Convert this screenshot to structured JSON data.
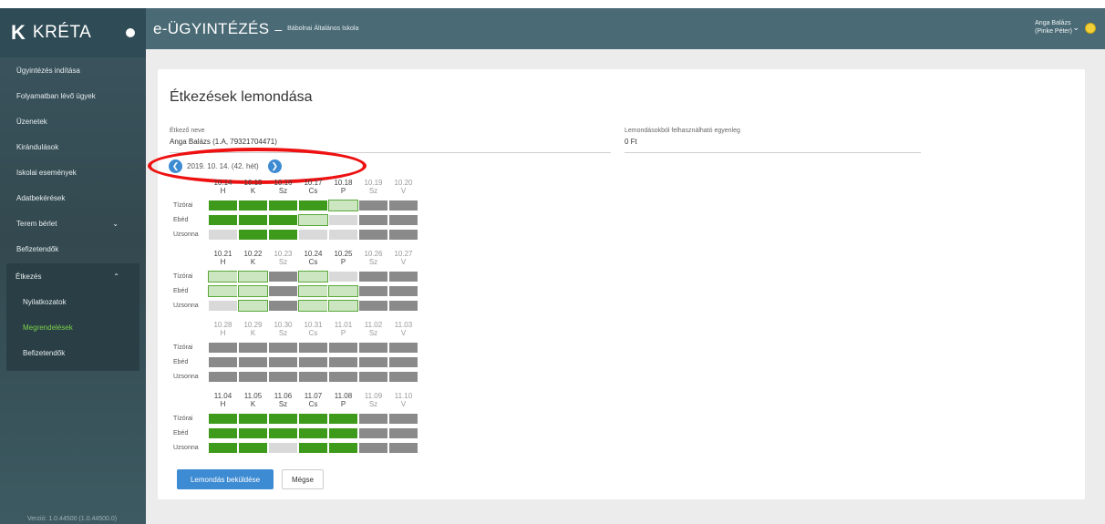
{
  "brand": {
    "name": "KRÉTA"
  },
  "header": {
    "app_title": "e-ÜGYINTÉZÉS",
    "dash": "–",
    "school": "Bábolnai Általános Iskola",
    "user_line1": "Anga Balázs",
    "user_line2": "(Pinke Péter)"
  },
  "sidebar": {
    "items": [
      {
        "label": "Ügyintézés indítása"
      },
      {
        "label": "Folyamatban lévő ügyek"
      },
      {
        "label": "Üzenetek"
      },
      {
        "label": "Kirándulások"
      },
      {
        "label": "Iskolai események"
      },
      {
        "label": "Adatbekérések"
      },
      {
        "label": "Terem bérlet"
      },
      {
        "label": "Befizetendők"
      }
    ],
    "group": {
      "label": "Étkezés",
      "children": [
        {
          "label": "Nyilatkozatok"
        },
        {
          "label": "Megrendelések"
        },
        {
          "label": "Befizetendők"
        }
      ]
    },
    "version": "Verzió: 1.0.44500 (1.0.44500.0)"
  },
  "page": {
    "title": "Étkezések lemondása",
    "etkezo_label": "Étkező neve",
    "etkezo_value": "Anga Balázs (1.A, 79321704471)",
    "egyenleg_label": "Lemondásokból felhasználható egyenleg",
    "egyenleg_value": "0 Ft",
    "week_label": "2019. 10. 14. (42. hét)",
    "submit_label": "Lemondás beküldése",
    "cancel_label": "Mégse"
  },
  "row_labels": [
    "Tízórai",
    "Ebéd",
    "Uzsonna"
  ],
  "weeks": [
    {
      "days": [
        {
          "date": "10.14",
          "day": "H",
          "dim": false
        },
        {
          "date": "10.15",
          "day": "K",
          "dim": false
        },
        {
          "date": "10.16",
          "day": "Sz",
          "dim": false
        },
        {
          "date": "10.17",
          "day": "Cs",
          "dim": false
        },
        {
          "date": "10.18",
          "day": "P",
          "dim": false
        },
        {
          "date": "10.19",
          "day": "Sz",
          "dim": true
        },
        {
          "date": "10.20",
          "day": "V",
          "dim": true
        }
      ],
      "rows": [
        [
          "g",
          "g",
          "g",
          "g",
          "gx",
          "d",
          "d"
        ],
        [
          "g",
          "g",
          "g",
          "gx",
          "l",
          "d",
          "d"
        ],
        [
          "l",
          "g",
          "g",
          "l",
          "l",
          "d",
          "d"
        ]
      ]
    },
    {
      "days": [
        {
          "date": "10.21",
          "day": "H",
          "dim": false
        },
        {
          "date": "10.22",
          "day": "K",
          "dim": false
        },
        {
          "date": "10.23",
          "day": "Sz",
          "dim": true
        },
        {
          "date": "10.24",
          "day": "Cs",
          "dim": false
        },
        {
          "date": "10.25",
          "day": "P",
          "dim": false
        },
        {
          "date": "10.26",
          "day": "Sz",
          "dim": true
        },
        {
          "date": "10.27",
          "day": "V",
          "dim": true
        }
      ],
      "rows": [
        [
          "gx",
          "gx",
          "d",
          "gx",
          "l",
          "d",
          "d"
        ],
        [
          "gx",
          "gx",
          "d",
          "gx",
          "gx",
          "d",
          "d"
        ],
        [
          "l",
          "gx",
          "d",
          "gx",
          "gx",
          "d",
          "d"
        ]
      ]
    },
    {
      "days": [
        {
          "date": "10.28",
          "day": "H",
          "dim": true
        },
        {
          "date": "10.29",
          "day": "K",
          "dim": true
        },
        {
          "date": "10.30",
          "day": "Sz",
          "dim": true
        },
        {
          "date": "10.31",
          "day": "Cs",
          "dim": true
        },
        {
          "date": "11.01",
          "day": "P",
          "dim": true
        },
        {
          "date": "11.02",
          "day": "Sz",
          "dim": true
        },
        {
          "date": "11.03",
          "day": "V",
          "dim": true
        }
      ],
      "rows": [
        [
          "d",
          "d",
          "d",
          "d",
          "d",
          "d",
          "d"
        ],
        [
          "d",
          "d",
          "d",
          "d",
          "d",
          "d",
          "d"
        ],
        [
          "d",
          "d",
          "d",
          "d",
          "d",
          "d",
          "d"
        ]
      ]
    },
    {
      "days": [
        {
          "date": "11.04",
          "day": "H",
          "dim": false
        },
        {
          "date": "11.05",
          "day": "K",
          "dim": false
        },
        {
          "date": "11.06",
          "day": "Sz",
          "dim": false
        },
        {
          "date": "11.07",
          "day": "Cs",
          "dim": false
        },
        {
          "date": "11.08",
          "day": "P",
          "dim": false
        },
        {
          "date": "11.09",
          "day": "Sz",
          "dim": true
        },
        {
          "date": "11.10",
          "day": "V",
          "dim": true
        }
      ],
      "rows": [
        [
          "g",
          "g",
          "g",
          "g",
          "g",
          "d",
          "d"
        ],
        [
          "g",
          "g",
          "g",
          "g",
          "g",
          "d",
          "d"
        ],
        [
          "g",
          "g",
          "l",
          "g",
          "g",
          "d",
          "d"
        ]
      ]
    }
  ],
  "colors": {
    "green": "#3e9a1a",
    "gray": "#8a8a8a",
    "light": "#d9d9d9",
    "blue": "#3d8bd3",
    "annotation": "#ee1111"
  }
}
